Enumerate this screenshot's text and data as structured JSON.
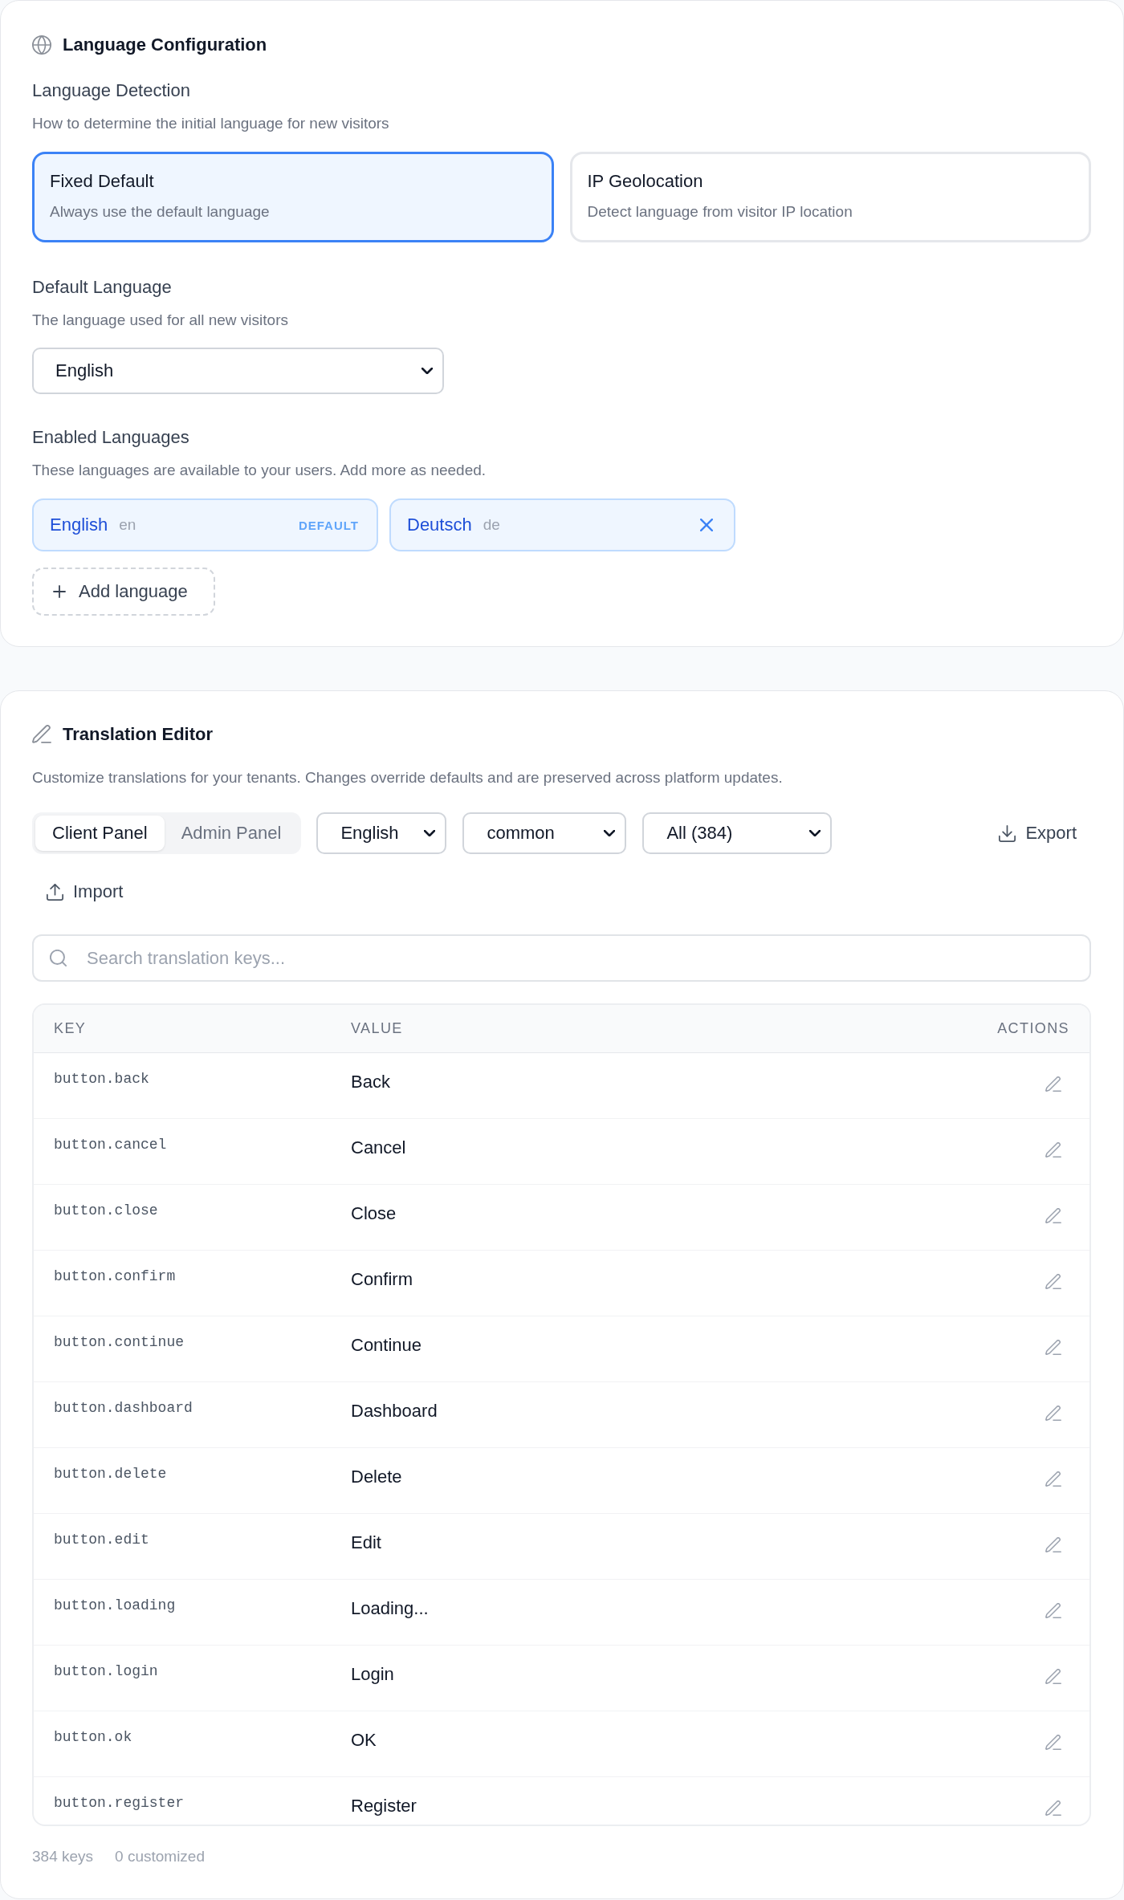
{
  "language_configuration": {
    "title": "Language Configuration",
    "detection": {
      "label": "Language Detection",
      "description": "How to determine the initial language for new visitors",
      "options": [
        {
          "title": "Fixed Default",
          "description": "Always use the default language",
          "selected": true
        },
        {
          "title": "IP Geolocation",
          "description": "Detect language from visitor IP location",
          "selected": false
        }
      ]
    },
    "default_language": {
      "label": "Default Language",
      "description": "The language used for all new visitors",
      "value": "English"
    },
    "enabled_languages": {
      "label": "Enabled Languages",
      "description": "These languages are available to your users. Add more as needed.",
      "languages": [
        {
          "name": "English",
          "code": "en",
          "default": true,
          "badge": "DEFAULT"
        },
        {
          "name": "Deutsch",
          "code": "de",
          "default": false
        }
      ],
      "add_button": "Add language"
    }
  },
  "translation_editor": {
    "title": "Translation Editor",
    "description": "Customize translations for your tenants. Changes override defaults and are preserved across platform updates.",
    "panel_tabs": [
      {
        "label": "Client Panel",
        "selected": true
      },
      {
        "label": "Admin Panel",
        "selected": false
      }
    ],
    "filters": [
      {
        "value": "English"
      },
      {
        "value": "common"
      },
      {
        "value": "All (384)"
      }
    ],
    "export_button": "Export",
    "import_button": "Import",
    "search": {
      "placeholder": "Search translation keys..."
    },
    "table": {
      "columns": [
        "KEY",
        "VALUE",
        "ACTIONS"
      ],
      "rows": [
        {
          "key": "button.back",
          "value": "Back"
        },
        {
          "key": "button.cancel",
          "value": "Cancel"
        },
        {
          "key": "button.close",
          "value": "Close"
        },
        {
          "key": "button.confirm",
          "value": "Confirm"
        },
        {
          "key": "button.continue",
          "value": "Continue"
        },
        {
          "key": "button.dashboard",
          "value": "Dashboard"
        },
        {
          "key": "button.delete",
          "value": "Delete"
        },
        {
          "key": "button.edit",
          "value": "Edit"
        },
        {
          "key": "button.loading",
          "value": "Loading..."
        },
        {
          "key": "button.login",
          "value": "Login"
        },
        {
          "key": "button.ok",
          "value": "OK"
        },
        {
          "key": "button.register",
          "value": "Register"
        }
      ]
    },
    "footer": {
      "total": "384 keys",
      "customized": "0 customized"
    }
  }
}
